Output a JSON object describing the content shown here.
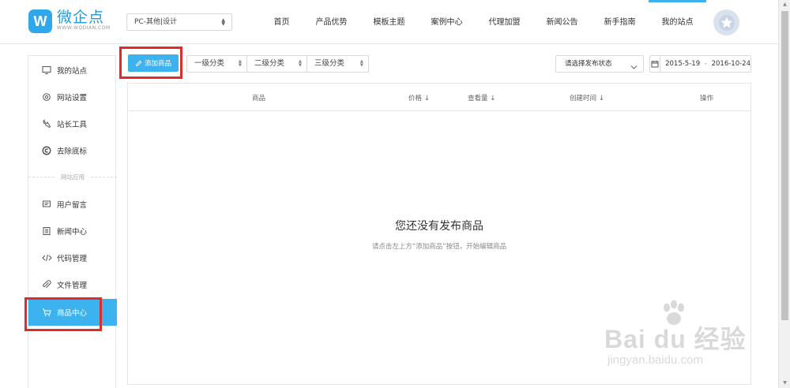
{
  "header": {
    "logo_glyph": "W",
    "logo_cn": "微企点",
    "logo_en": "WWW.WQDIAN.COM",
    "site_select": "PC-其他|设计",
    "nav": [
      {
        "label": "首页"
      },
      {
        "label": "产品优势"
      },
      {
        "label": "模板主题"
      },
      {
        "label": "案例中心"
      },
      {
        "label": "代理加盟"
      },
      {
        "label": "新闻公告"
      },
      {
        "label": "新手指南"
      },
      {
        "label": "我的站点",
        "active": true
      }
    ],
    "avatar_icon": "star-avatar-icon"
  },
  "sidebar": {
    "items": [
      {
        "label": "我的站点",
        "icon": "monitor-icon"
      },
      {
        "label": "网站设置",
        "icon": "gear-icon"
      },
      {
        "label": "站长工具",
        "icon": "wrench-icon"
      },
      {
        "label": "去除底标",
        "icon": "copyright-icon"
      },
      {
        "label": "用户留言",
        "icon": "message-icon"
      },
      {
        "label": "新闻中心",
        "icon": "document-icon"
      },
      {
        "label": "代码管理",
        "icon": "code-icon"
      },
      {
        "label": "文件管理",
        "icon": "paperclip-icon"
      },
      {
        "label": "商品中心",
        "icon": "cart-icon",
        "active": true
      }
    ],
    "group_label": "网站应用"
  },
  "toolbar": {
    "add_label": "添加商品",
    "categories": [
      "一级分类",
      "二级分类",
      "三级分类"
    ],
    "status_placeholder": "请选择发布状态",
    "date_start": "2015-5-19",
    "date_sep": "-",
    "date_end": "2016-10-24"
  },
  "table": {
    "columns": {
      "product": "商品",
      "price": "价格 ↓",
      "views": "查看量 ↓",
      "created": "创建时间 ↓",
      "actions": "操作"
    },
    "empty_title": "您还没有发布商品",
    "empty_hint": "请点击左上方“添加商品”按钮，开始编辑商品"
  },
  "watermark": {
    "main": "Bai du 经验",
    "sub": "jingyan.baidu.com"
  },
  "colors": {
    "accent": "#3cb3ef",
    "highlight": "#e02b2b"
  }
}
